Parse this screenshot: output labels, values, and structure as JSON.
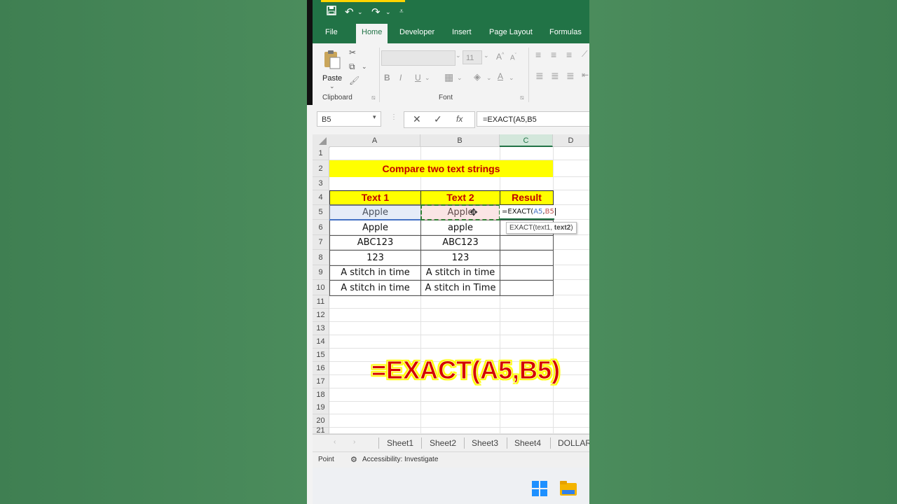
{
  "qat": {
    "undo_icon": "undo-icon",
    "redo_icon": "redo-icon",
    "save_icon": "save-icon"
  },
  "tabs": [
    "File",
    "Home",
    "Developer",
    "Insert",
    "Page Layout",
    "Formulas"
  ],
  "ribbon": {
    "paste_label": "Paste",
    "font_name": "",
    "font_size": "11",
    "groups": [
      "Clipboard",
      "Font"
    ],
    "format_buttons": [
      "B",
      "I",
      "U"
    ]
  },
  "formula_bar": {
    "name_box": "B5",
    "formula": "=EXACT(A5,B5"
  },
  "grid": {
    "col_headers": [
      "A",
      "B",
      "C",
      "D"
    ],
    "row_headers": [
      "1",
      "2",
      "3",
      "4",
      "5",
      "6",
      "7",
      "8",
      "9",
      "10",
      "11",
      "12",
      "13",
      "14",
      "15",
      "16",
      "17",
      "18",
      "19",
      "20",
      "21"
    ],
    "title": "Compare two text strings",
    "headers": [
      "Text 1",
      "Text 2",
      "Result"
    ],
    "rows": [
      [
        "Apple",
        "Apple",
        ""
      ],
      [
        "Apple",
        "apple",
        ""
      ],
      [
        "ABC123",
        "ABC123",
        ""
      ],
      [
        "123",
        "123",
        ""
      ],
      [
        "A stitch in time",
        "A stitch in time",
        ""
      ],
      [
        "A stitch in time",
        "A stitch in Time",
        ""
      ]
    ],
    "edit_cell": {
      "prefix": "=EXACT(",
      "ref1": "A5",
      "sep": ",",
      "ref2": "B5"
    },
    "tooltip": {
      "fn": "EXACT(text1, ",
      "arg": "text2",
      "close": ")"
    }
  },
  "sheets": [
    "Sheet1",
    "Sheet2",
    "Sheet3",
    "Sheet4",
    "DOLLAR"
  ],
  "status": {
    "mode": "Point",
    "accessibility": "Accessibility: Investigate"
  },
  "overlay_text": "=EXACT(A5,B5)",
  "colors": {
    "excel_green": "#217346",
    "header_yellow": "#ffff00",
    "header_red": "#c00000"
  }
}
